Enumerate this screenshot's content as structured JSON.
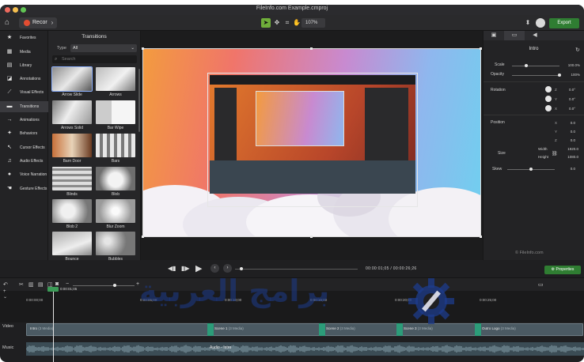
{
  "window": {
    "title": "FileInfo.com Example.cmproj"
  },
  "toolbar": {
    "record_label": "Record",
    "zoom_value": "107%",
    "export_label": "Export"
  },
  "left_nav": {
    "items": [
      {
        "label": "Favorites",
        "icon": "star-icon"
      },
      {
        "label": "Media",
        "icon": "film-icon"
      },
      {
        "label": "Library",
        "icon": "library-icon"
      },
      {
        "label": "Annotations",
        "icon": "annotation-icon"
      },
      {
        "label": "Visual Effects",
        "icon": "wand-icon"
      },
      {
        "label": "Transitions",
        "icon": "transitions-icon"
      },
      {
        "label": "Animations",
        "icon": "arrow-icon"
      },
      {
        "label": "Behaviors",
        "icon": "behavior-icon"
      },
      {
        "label": "Cursor Effects",
        "icon": "cursor-icon"
      },
      {
        "label": "Audio Effects",
        "icon": "audio-icon"
      },
      {
        "label": "Voice Narration",
        "icon": "mic-icon"
      },
      {
        "label": "Gesture Effects",
        "icon": "hand-icon"
      }
    ],
    "active_index": 5
  },
  "transitions": {
    "title": "Transitions",
    "type_label": "Type",
    "type_value": "All",
    "search_placeholder": "Search",
    "tiles": [
      "Arrow Slide",
      "Arrows",
      "Arrows Solid",
      "Bar Wipe",
      "Barn Door",
      "Bars",
      "Blinds",
      "Blob",
      "Blob 2",
      "Blur Zoom",
      "Bounce",
      "Bubbles"
    ]
  },
  "properties": {
    "heading": "Intro",
    "scale_label": "Scale",
    "scale_value": "100.0%",
    "scale_level": 0.3,
    "opacity_label": "Opacity",
    "opacity_value": "100%",
    "opacity_level": 1.0,
    "rotation_label": "Rotation",
    "rotation": {
      "z": "0.0°",
      "y": "0.0°",
      "x": "0.0°"
    },
    "position_label": "Position",
    "position": {
      "x": "0.0",
      "y": "0.0",
      "z": "0.0"
    },
    "size_label": "Size",
    "width_label": "Width",
    "width_value": "1920.0",
    "height_label": "Height",
    "height_value": "1080.0",
    "skew_label": "Skew",
    "skew_value": "0.0",
    "skew_level": 0.5,
    "watermark": "© FileInfo.com"
  },
  "playback": {
    "timecode": "00:00:01;05 / 00:00:26;26",
    "properties_label": "Properties",
    "progress": 0.05
  },
  "timeline": {
    "zoom_level": 0.68,
    "playhead_time": "0:00:01;05",
    "ticks": [
      "0:00:00;00",
      "0:00:05;00",
      "0:00:10;00",
      "0:00:15;00",
      "0:00:20;00",
      "0:00:25;00"
    ],
    "tracks": [
      {
        "name": "Video",
        "clips": [
          {
            "title": "Intro",
            "sub": "(3 Media)",
            "start": 0.0,
            "end": 0.33
          },
          {
            "title": "Scene 1",
            "sub": "(3 Media)",
            "start": 0.33,
            "end": 0.53
          },
          {
            "title": "Scene 2",
            "sub": "(3 Media)",
            "start": 0.53,
            "end": 0.67
          },
          {
            "title": "Scene 3",
            "sub": "(3 Media)",
            "start": 0.67,
            "end": 0.81
          },
          {
            "title": "Outro Logo",
            "sub": "(3 Media)",
            "start": 0.81,
            "end": 1.0
          }
        ]
      },
      {
        "name": "Music",
        "clips": [
          {
            "title": "Audio - Intro",
            "sub": "",
            "start": 0.0,
            "end": 1.0
          }
        ]
      }
    ]
  },
  "watermark_overlay": {
    "text": "برامج العربية"
  },
  "colors": {
    "accent_green": "#2f7d32",
    "record_red": "#e34d32",
    "transition_teal": "#2c9c79"
  }
}
